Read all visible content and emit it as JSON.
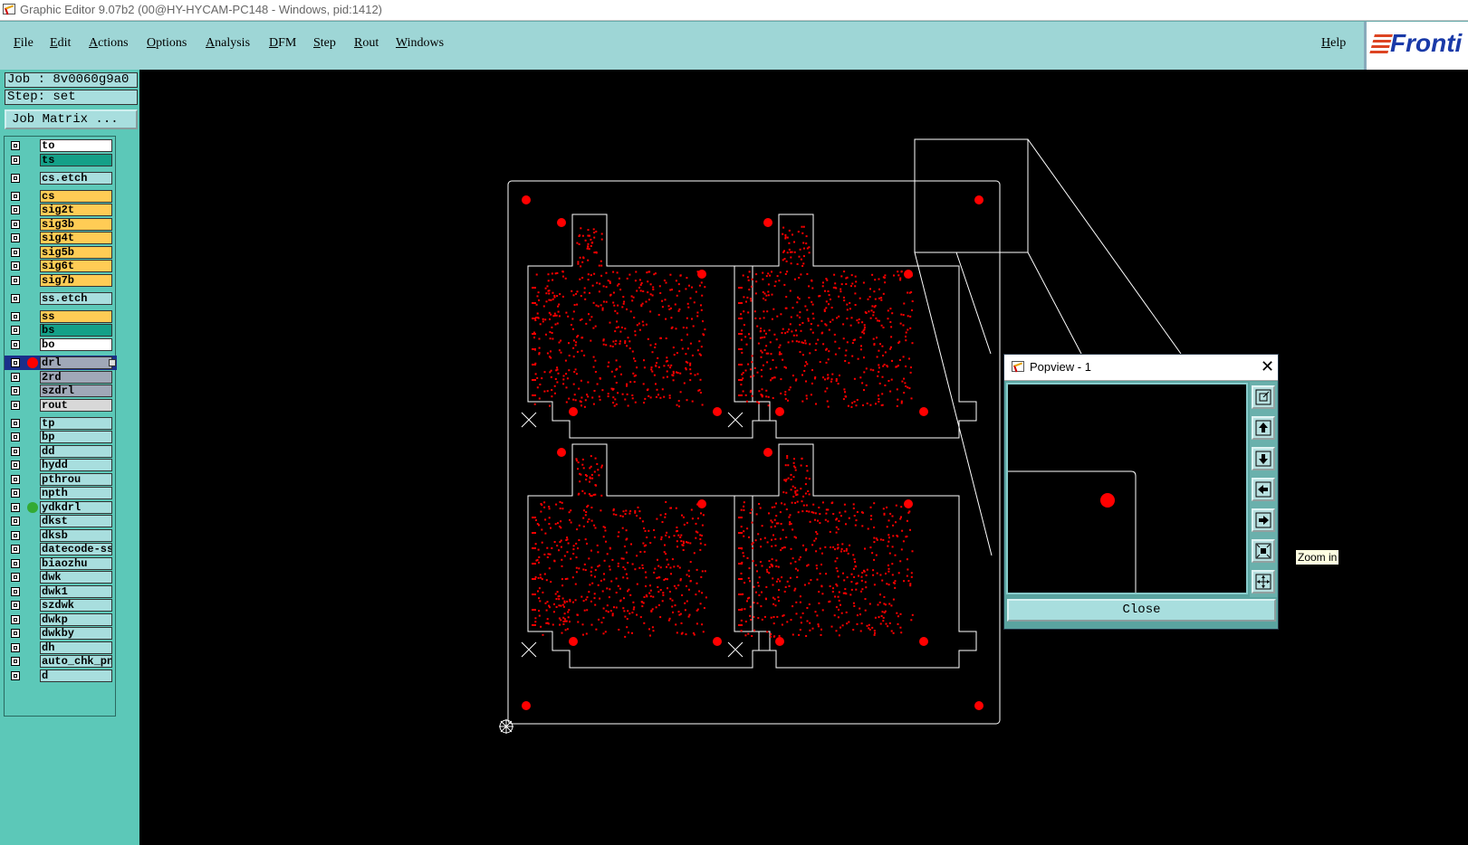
{
  "window": {
    "title": "Graphic Editor 9.07b2 (00@HY-HYCAM-PC148 - Windows, pid:1412)"
  },
  "menu": {
    "items": [
      "File",
      "Edit",
      "Actions",
      "Options",
      "Analysis",
      "DFM",
      "Step",
      "Rout",
      "Windows"
    ],
    "help": "Help",
    "logo": "Fronti"
  },
  "job": {
    "job_label": "Job : 8v0060g9a0",
    "step_label": "Step: set",
    "matrix_button": "Job Matrix ..."
  },
  "layers": [
    {
      "name": "to",
      "color": "#ffffff"
    },
    {
      "name": "ts",
      "color": "#14a088"
    },
    {
      "name": "cs.etch",
      "color": "#a8dede"
    },
    {
      "name": "cs",
      "color": "#ffcc55"
    },
    {
      "name": "sig2t",
      "color": "#ffcc55"
    },
    {
      "name": "sig3b",
      "color": "#ffcc55"
    },
    {
      "name": "sig4t",
      "color": "#ffcc55"
    },
    {
      "name": "sig5b",
      "color": "#ffcc55"
    },
    {
      "name": "sig6t",
      "color": "#ffcc55"
    },
    {
      "name": "sig7b",
      "color": "#ffcc55"
    },
    {
      "name": "ss.etch",
      "color": "#a8dede"
    },
    {
      "name": "ss",
      "color": "#ffcc55"
    },
    {
      "name": "bs",
      "color": "#14a088"
    },
    {
      "name": "bo",
      "color": "#ffffff"
    },
    {
      "name": "drl",
      "color": "#a0a8b8",
      "active": true,
      "dot": "#ff0000"
    },
    {
      "name": "2rd",
      "color": "#a0a8b8"
    },
    {
      "name": "szdrl",
      "color": "#a0a8b8"
    },
    {
      "name": "rout",
      "color": "#d8d8d8"
    },
    {
      "name": "tp",
      "color": "#a8dede"
    },
    {
      "name": "bp",
      "color": "#a8dede"
    },
    {
      "name": "dd",
      "color": "#a8dede"
    },
    {
      "name": "hydd",
      "color": "#a8dede"
    },
    {
      "name": "pthrou",
      "color": "#a8dede"
    },
    {
      "name": "npth",
      "color": "#a8dede"
    },
    {
      "name": "ydkdrl",
      "color": "#a8dede",
      "dot": "#33aa33"
    },
    {
      "name": "dkst",
      "color": "#a8dede"
    },
    {
      "name": "dksb",
      "color": "#a8dede"
    },
    {
      "name": "datecode-ss",
      "color": "#a8dede"
    },
    {
      "name": "biaozhu",
      "color": "#a8dede"
    },
    {
      "name": "dwk",
      "color": "#a8dede"
    },
    {
      "name": "dwk1",
      "color": "#a8dede"
    },
    {
      "name": "szdwk",
      "color": "#a8dede"
    },
    {
      "name": "dwkp",
      "color": "#a8dede"
    },
    {
      "name": "dwkby",
      "color": "#a8dede"
    },
    {
      "name": "dh",
      "color": "#a8dede"
    },
    {
      "name": "auto_chk_pn.",
      "color": "#a8dede"
    },
    {
      "name": "d",
      "color": "#a8dede"
    }
  ],
  "popview": {
    "title": "Popview - 1",
    "close_glyph": "✕",
    "close_button": "Close",
    "tools": [
      "zoom-home-icon",
      "pan-up-icon",
      "pan-down-icon",
      "pan-left-icon",
      "pan-right-icon",
      "zoom-in-icon",
      "zoom-out-icon"
    ],
    "tooltip": "Zoom in"
  },
  "colors": {
    "menubar": "#9ed6d6",
    "panel": "#5cc8b8",
    "pad": "#ff0000",
    "outline": "#ffffff"
  }
}
